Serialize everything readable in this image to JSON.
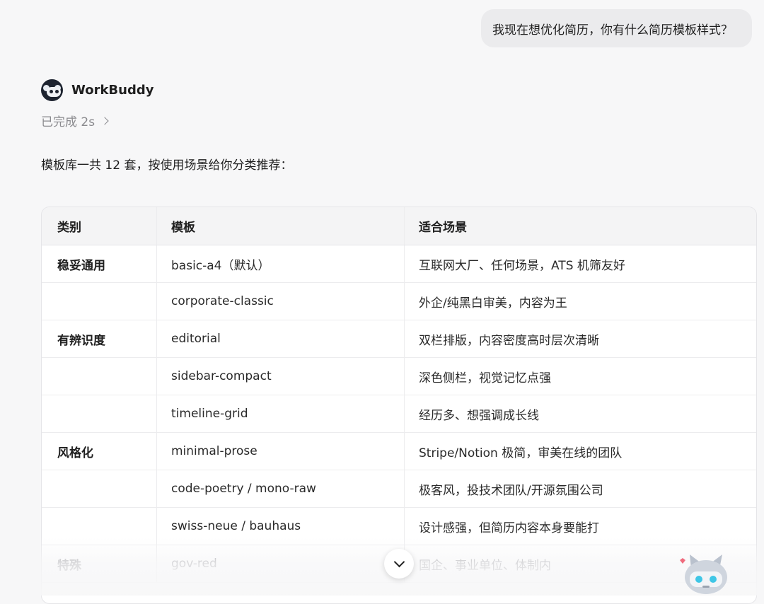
{
  "user_message": "我现在想优化简历，你有什么简历模板样式？",
  "assistant": {
    "name": "WorkBuddy",
    "status": "已完成 2s",
    "intro": "模板库一共 12 套，按使用场景给你分类推荐："
  },
  "table": {
    "headers": [
      "类别",
      "模板",
      "适合场景"
    ],
    "rows": [
      {
        "category": "稳妥通用",
        "template": "basic-a4（默认）",
        "scene": "互联网大厂、任何场景，ATS 机筛友好"
      },
      {
        "category": "",
        "template": "corporate-classic",
        "scene": "外企/纯黑白审美，内容为王"
      },
      {
        "category": "有辨识度",
        "template": "editorial",
        "scene": "双栏排版，内容密度高时层次清晰"
      },
      {
        "category": "",
        "template": "sidebar-compact",
        "scene": "深色侧栏，视觉记忆点强"
      },
      {
        "category": "",
        "template": "timeline-grid",
        "scene": "经历多、想强调成长线"
      },
      {
        "category": "风格化",
        "template": "minimal-prose",
        "scene": "Stripe/Notion 极简，审美在线的团队"
      },
      {
        "category": "",
        "template": "code-poetry / mono-raw",
        "scene": "极客风，投技术团队/开源氛围公司"
      },
      {
        "category": "",
        "template": "swiss-neue / bauhaus",
        "scene": "设计感强，但简历内容本身要能打"
      },
      {
        "category": "特殊",
        "template": "gov-red",
        "scene": "国企、事业单位、体制内"
      }
    ]
  },
  "icons": {
    "avatar": "raccoon-avatar-icon",
    "status_chevron": "chevron-right-icon",
    "scroll_down": "chevron-down-icon",
    "mascot": "robot-cat-mascot-icon"
  },
  "colors": {
    "page_bg": "#f7f7f8",
    "bubble_bg": "#ebebed",
    "table_header_bg": "#f4f4f5",
    "muted_text": "#8a8a8e"
  }
}
